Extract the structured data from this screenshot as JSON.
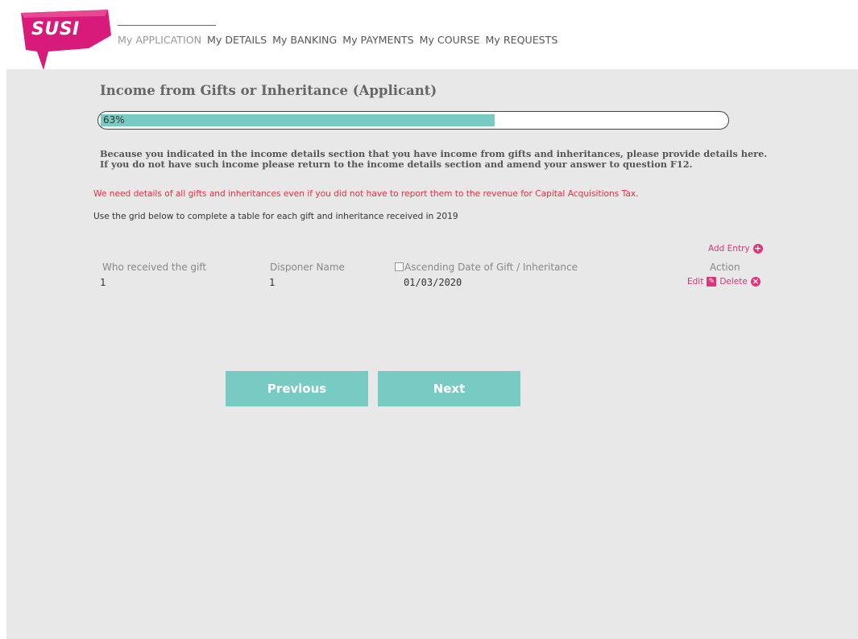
{
  "brand": {
    "logo_text": "SUSI",
    "primary_color": "#d81b7a",
    "accent_color": "#78cbc3"
  },
  "nav": {
    "items": [
      {
        "label": "My APPLICATION",
        "active": true
      },
      {
        "label": "My DETAILS"
      },
      {
        "label": "My BANKING"
      },
      {
        "label": "My PAYMENTS"
      },
      {
        "label": "My COURSE"
      },
      {
        "label": "My REQUESTS"
      }
    ]
  },
  "page": {
    "title": "Income from Gifts or Inheritance (Applicant)",
    "progress": {
      "percent": 63,
      "label": "63%"
    },
    "intro": "Because you indicated in the income details section that you have income from gifts and inheritances, please provide details here. If you do not have such income please return to the income details section and amend your answer to question F12.",
    "warning": "We need details of all gifts and inheritances even if you did not have to report them to the revenue for Capital Acquisitions Tax.",
    "instruction": "Use the grid below to complete a table for each gift and inheritance received in 2019"
  },
  "grid": {
    "add_entry_label": "Add Entry",
    "columns": {
      "who": "Who received the gift",
      "disponer": "Disponer Name",
      "date_img_alt": "Ascending",
      "date": "Date of Gift / Inheritance",
      "action": "Action"
    },
    "rows": [
      {
        "who": "1",
        "disponer": "1",
        "date": "01/03/2020",
        "edit_label": "Edit",
        "delete_label": "Delete"
      }
    ]
  },
  "buttons": {
    "previous": "Previous",
    "next": "Next"
  }
}
